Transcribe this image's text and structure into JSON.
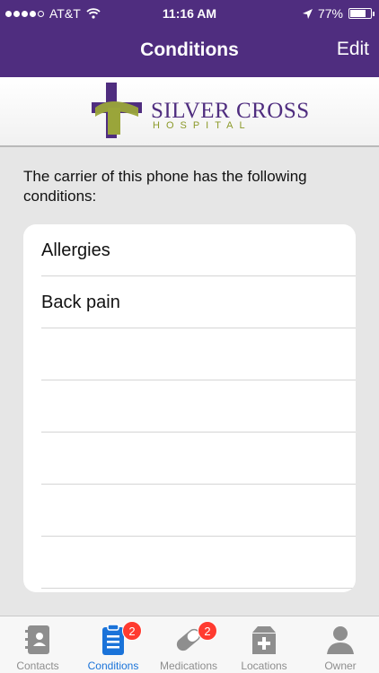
{
  "status": {
    "carrier": "AT&T",
    "time": "11:16 AM",
    "battery": "77%",
    "battery_level": 0.77
  },
  "nav": {
    "title": "Conditions",
    "edit": "Edit"
  },
  "brand": {
    "name": "SILVER CROSS",
    "sub": "HOSPITAL",
    "purple": "#4f2d7f",
    "green": "#8c9a2a"
  },
  "intro": "The carrier of this phone has the following conditions:",
  "conditions": [
    "Allergies",
    "Back pain",
    "",
    "",
    "",
    "",
    ""
  ],
  "tabs": [
    {
      "label": "Contacts",
      "badge": ""
    },
    {
      "label": "Conditions",
      "badge": "2"
    },
    {
      "label": "Medications",
      "badge": "2"
    },
    {
      "label": "Locations",
      "badge": ""
    },
    {
      "label": "Owner",
      "badge": ""
    }
  ]
}
